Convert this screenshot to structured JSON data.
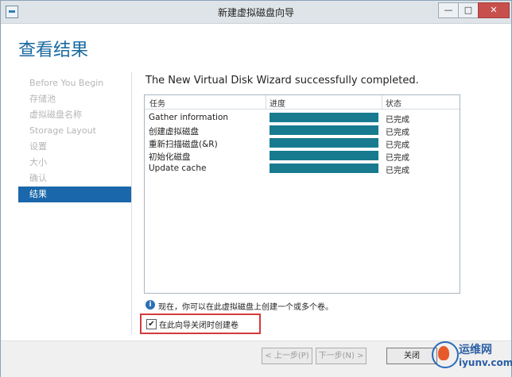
{
  "window": {
    "title": "新建虚拟磁盘向导",
    "controls": {
      "minimize": "—",
      "maximize": "□",
      "close": "✕"
    }
  },
  "page_title": "查看结果",
  "nav": {
    "items": [
      {
        "label": "Before You Begin",
        "active": false
      },
      {
        "label": "存储池",
        "active": false
      },
      {
        "label": "虚拟磁盘名称",
        "active": false
      },
      {
        "label": "Storage Layout",
        "active": false
      },
      {
        "label": "设置",
        "active": false
      },
      {
        "label": "大小",
        "active": false
      },
      {
        "label": "确认",
        "active": false
      },
      {
        "label": "结果",
        "active": true
      }
    ]
  },
  "status_message": "The New Virtual Disk Wizard successfully completed.",
  "results_table": {
    "headers": {
      "task": "任务",
      "progress": "进度",
      "status": "状态"
    },
    "rows": [
      {
        "task": "Gather information",
        "progress": 1.0,
        "status": "已完成"
      },
      {
        "task": "创建虚拟磁盘",
        "progress": 1.0,
        "status": "已完成"
      },
      {
        "task": "重新扫描磁盘(&R)",
        "progress": 1.0,
        "status": "已完成"
      },
      {
        "task": "初始化磁盘",
        "progress": 1.0,
        "status": "已完成"
      },
      {
        "task": "Update cache",
        "progress": 1.0,
        "status": "已完成"
      }
    ]
  },
  "info": {
    "icon": "info-icon",
    "text": "现在，你可以在此虚拟磁盘上创建一个或多个卷。"
  },
  "create_volume_checkbox": {
    "checked": true,
    "label": "在此向导关闭时创建卷"
  },
  "buttons": {
    "prev": "< 上一步(P)",
    "next": "下一步(N) >",
    "close": "关闭"
  },
  "watermark": {
    "title": "运维网",
    "site": "iyunv.com"
  },
  "colors": {
    "accent": "#1a68ab",
    "progress": "#177a8f",
    "highlight_border": "#d43a3a"
  }
}
